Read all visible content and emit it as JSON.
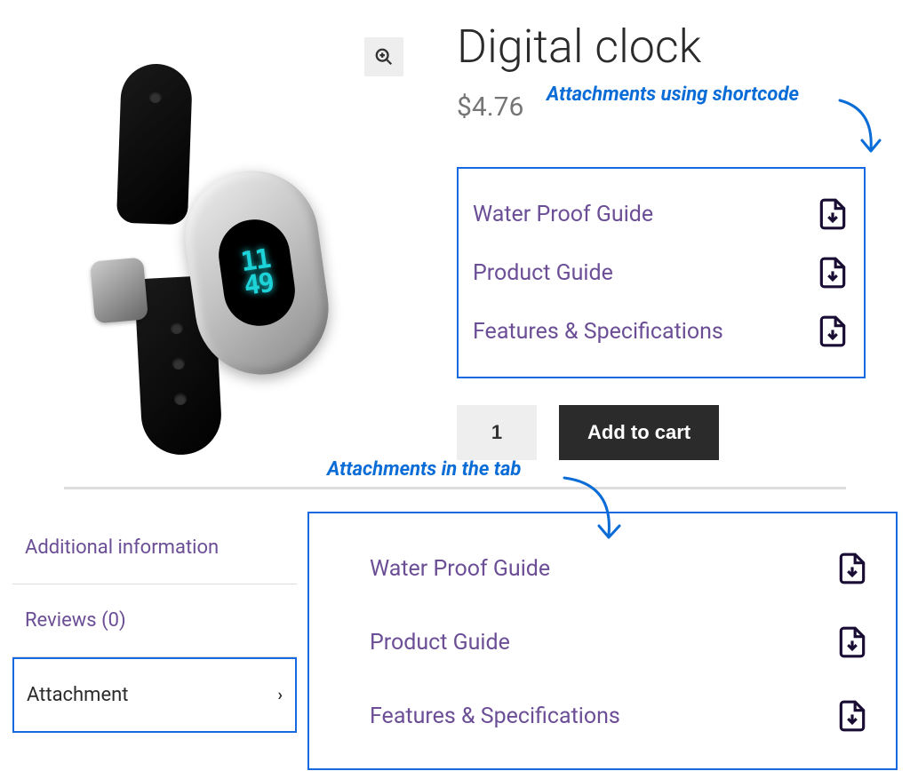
{
  "product": {
    "title": "Digital clock",
    "price": "$4.76",
    "time_display_line1": "11",
    "time_display_line2": "49",
    "quantity": "1",
    "add_to_cart_label": "Add to cart"
  },
  "attachments_top": [
    {
      "label": "Water Proof Guide"
    },
    {
      "label": "Product Guide"
    },
    {
      "label": "Features & Specifications"
    }
  ],
  "attachments_tab": [
    {
      "label": "Water Proof Guide"
    },
    {
      "label": "Product Guide"
    },
    {
      "label": "Features & Specifications"
    }
  ],
  "tabs": {
    "additional_info": "Additional information",
    "reviews": "Reviews (0)",
    "attachment": "Attachment"
  },
  "annotations": {
    "shortcode": "Attachments using shortcode",
    "tab": "Attachments in the tab"
  }
}
